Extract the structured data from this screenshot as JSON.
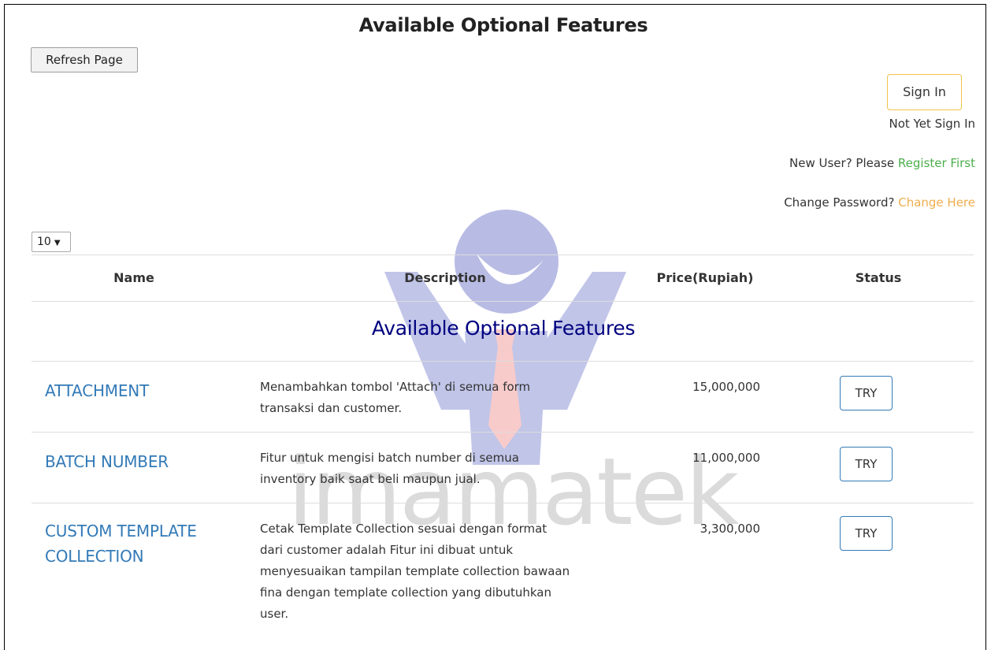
{
  "header": {
    "title": "Available Optional Features",
    "refresh_label": "Refresh Page"
  },
  "account": {
    "signin_label": "Sign In",
    "status": "Not Yet Sign In",
    "register_prefix": "New User? Please",
    "register_link": "Register First",
    "change_prefix": "Change Password?",
    "change_link": "Change Here",
    "colors": {
      "register": "#4cae4c",
      "change": "#f0ad4e",
      "signin_border": "#f0c24a"
    }
  },
  "table": {
    "page_size": "10",
    "columns": [
      "Name",
      "Description",
      "Price(Rupiah)",
      "Status"
    ],
    "group_title": "Available Optional Features",
    "rows": [
      {
        "name": [
          "ATTACHMENT"
        ],
        "description": [
          "Menambahkan tombol 'Attach' di semua form",
          "transaksi dan customer."
        ],
        "price": "15,000,000",
        "action": "TRY"
      },
      {
        "name": [
          "BATCH NUMBER"
        ],
        "description": [
          "Fitur untuk mengisi batch number di semua",
          "inventory baik saat beli maupun jual."
        ],
        "price": "11,000,000",
        "action": "TRY"
      },
      {
        "name": [
          "CUSTOM TEMPLATE",
          "COLLECTION"
        ],
        "description": [
          "Cetak Template Collection sesuai dengan format",
          "dari customer adalah Fitur ini dibuat untuk",
          "menyesuaikan tampilan template collection bawaan",
          "fina dengan template collection yang dibutuhkan",
          "user."
        ],
        "price": "3,300,000",
        "action": "TRY"
      }
    ]
  },
  "watermark": {
    "text": "imamatek",
    "colors": {
      "primary": "#8f96d6",
      "tie": "#f4a1a1",
      "text": "#c4c4c4"
    }
  }
}
